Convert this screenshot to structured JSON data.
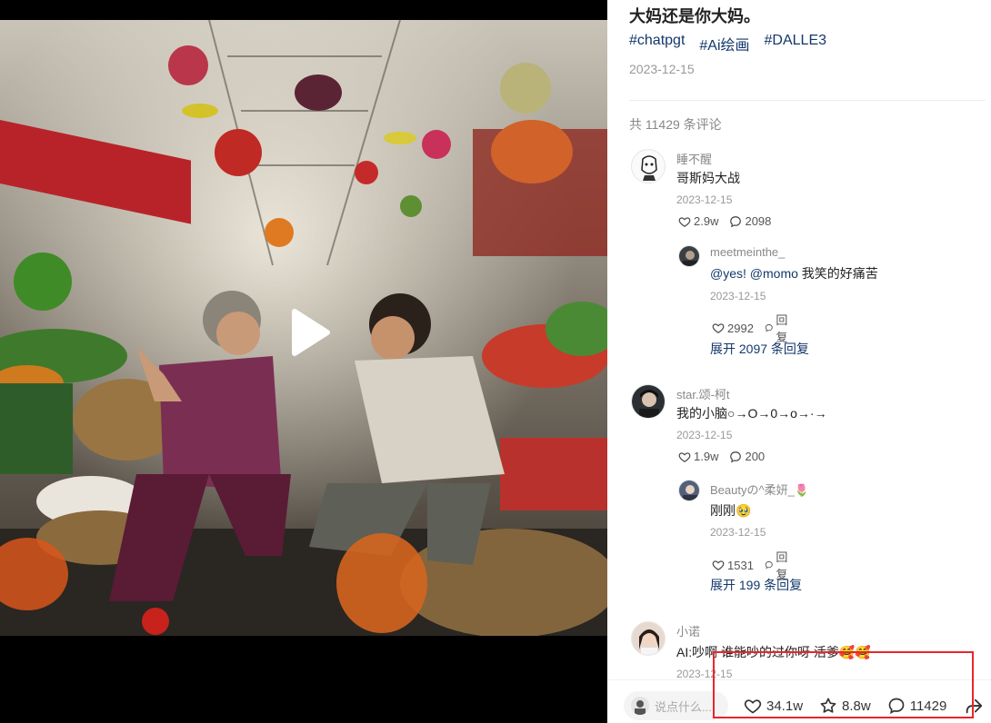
{
  "post": {
    "title": "大妈还是你大妈。",
    "tags": [
      "#chatpgt",
      "#Ai绘画",
      "#DALLE3"
    ],
    "date": "2023-12-15"
  },
  "comments_header": "共 11429 条评论",
  "comments": [
    {
      "name": "睡不醒",
      "text": "哥斯妈大战",
      "date": "2023-12-15",
      "likes": "2.9w",
      "replies_count": "2098"
    },
    {
      "name": "meetmeinthe_",
      "text_mentions": [
        "@yes!",
        "@momo"
      ],
      "text": "我笑的好痛苦",
      "date": "2023-12-15",
      "likes": "2992",
      "reply_label": "回复",
      "expand": "展开 2097 条回复"
    },
    {
      "name": "star.颂-柯t",
      "text": "我的小脑○→O→0→o→·→",
      "date": "2023-12-15",
      "likes": "1.9w",
      "replies_count": "200"
    },
    {
      "name": "Beautyの^柔妍_🌷",
      "text": "刚刚🥹",
      "date": "2023-12-15",
      "likes": "1531",
      "reply_label": "回复",
      "expand": "展开 199 条回复"
    },
    {
      "name": "小诺",
      "text": "AI:吵啊 谁能吵的过你呀 活爹🥰🥰",
      "date": "2023-12-15"
    }
  ],
  "bottom_bar": {
    "input_placeholder": "说点什么...",
    "likes": "34.1w",
    "collects": "8.8w",
    "comments": "11429"
  },
  "colors": {
    "tag": "#13386c",
    "highlight": "#e8262b",
    "media_bg": "#000000"
  },
  "icons": [
    "play-icon",
    "heart-icon",
    "comment-icon",
    "star-icon",
    "share-icon"
  ]
}
